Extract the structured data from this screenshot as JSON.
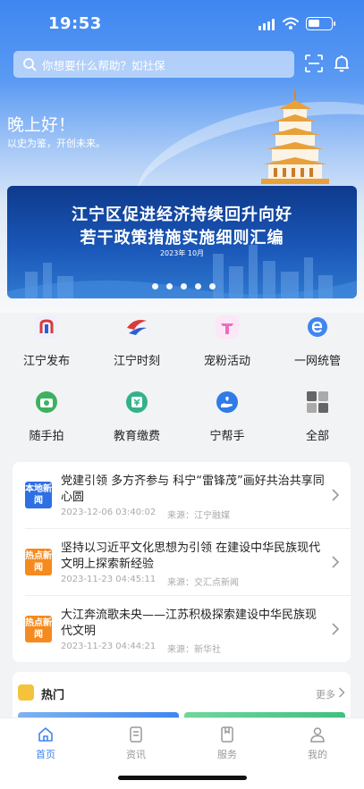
{
  "status_bar": {
    "time": "19:53"
  },
  "search": {
    "placeholder": "你想要什么帮助？如社保"
  },
  "hero": {
    "greeting": "晚上好！",
    "subtitle": "以史为鉴，开创未来。"
  },
  "banner": {
    "line1": "江宁区促进经济持续回升向好",
    "line2": "若干政策措施实施细则汇编",
    "line3": "2023年 10月",
    "slide_count": 5
  },
  "services": [
    {
      "label": "江宁发布",
      "icon": "jiangning-release-icon"
    },
    {
      "label": "江宁时刻",
      "icon": "jiangning-moment-icon"
    },
    {
      "label": "宠粉活动",
      "icon": "fan-gift-icon"
    },
    {
      "label": "一网统管",
      "icon": "unified-management-icon"
    },
    {
      "label": "随手拍",
      "icon": "camera-icon"
    },
    {
      "label": "教育缴费",
      "icon": "education-payment-icon"
    },
    {
      "label": "宁帮手",
      "icon": "helping-hand-icon"
    },
    {
      "label": "全部",
      "icon": "all-apps-icon"
    }
  ],
  "news": [
    {
      "tag": "本地新闻",
      "tag_color": "#2f6fe4",
      "title": "党建引领 多方齐参与 科宁“雷锋茂”画好共治共享同心圆",
      "date": "2023-12-06 03:40:02",
      "source": "来源：江宁融媒"
    },
    {
      "tag": "热点新闻",
      "tag_color": "#f58a1f",
      "title": "坚持以习近平文化思想为引领 在建设中华民族现代文明上探索新经验",
      "date": "2023-11-23 04:45:11",
      "source": "来源：交汇点新闻"
    },
    {
      "tag": "热点新闻",
      "tag_color": "#f58a1f",
      "title": "大江奔流歌未央——江苏积极探索建设中华民族现代文明",
      "date": "2023-11-23 04:44:21",
      "source": "来源：新华社"
    }
  ],
  "hot": {
    "title": "热门",
    "more": "更多"
  },
  "tabs": [
    {
      "label": "首页",
      "active": true
    },
    {
      "label": "资讯",
      "active": false
    },
    {
      "label": "服务",
      "active": false
    },
    {
      "label": "我的",
      "active": false
    }
  ],
  "colors": {
    "accent": "#3f86f0",
    "local_tag": "#2f6fe4",
    "hot_tag": "#f58a1f"
  }
}
